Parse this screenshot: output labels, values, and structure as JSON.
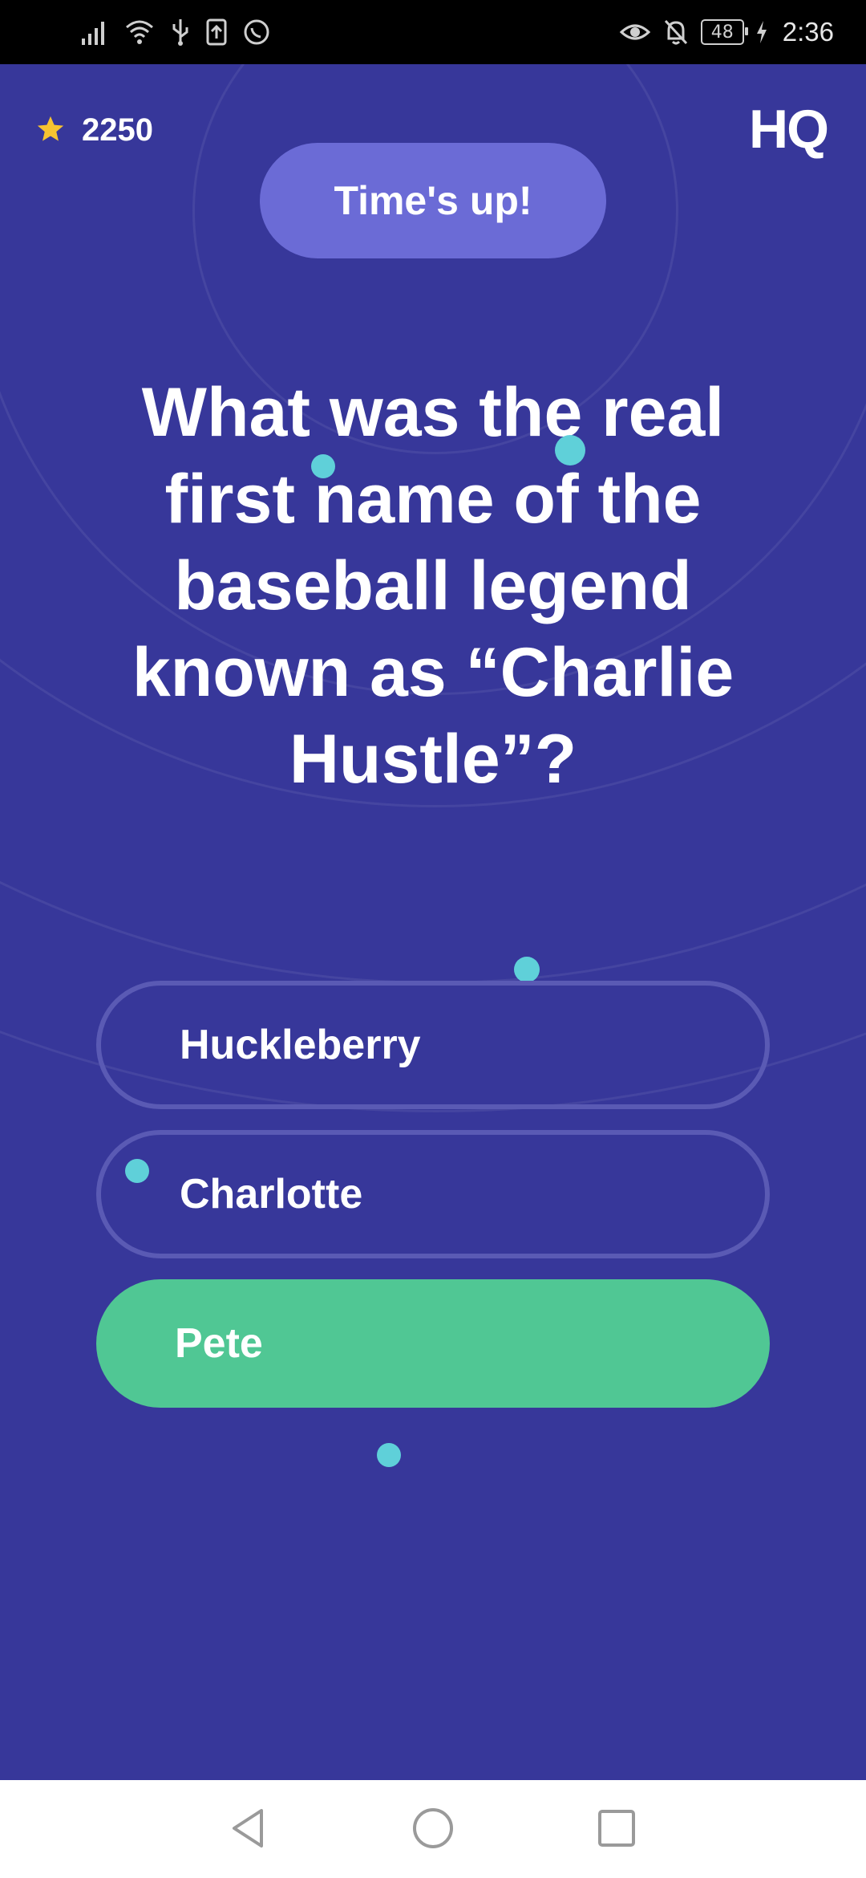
{
  "status_bar": {
    "time": "2:36",
    "battery_level": "48",
    "icons": [
      "signal-icon",
      "wifi-icon",
      "usb-icon",
      "upload-icon",
      "whatsapp-icon",
      "eye-icon",
      "bell-off-icon",
      "battery-icon",
      "charging-icon"
    ]
  },
  "header": {
    "score": "2250",
    "star_color": "#f7c331",
    "logo": "HQ"
  },
  "timer_banner": {
    "label": "Time's up!"
  },
  "question": {
    "text": "What was the real first name of the baseball legend known as “Charlie Hustle”?"
  },
  "answers": [
    {
      "label": "Huckleberry",
      "state": "default"
    },
    {
      "label": "Charlotte",
      "state": "default"
    },
    {
      "label": "Pete",
      "state": "correct"
    }
  ],
  "colors": {
    "background": "#37379a",
    "timer_pill": "#6b6bd6",
    "correct": "#50c794",
    "outline": "#5a5ab4",
    "dot": "#5fd0d9"
  },
  "nav_bar": {
    "buttons": [
      "back-icon",
      "home-icon",
      "recents-icon"
    ]
  }
}
